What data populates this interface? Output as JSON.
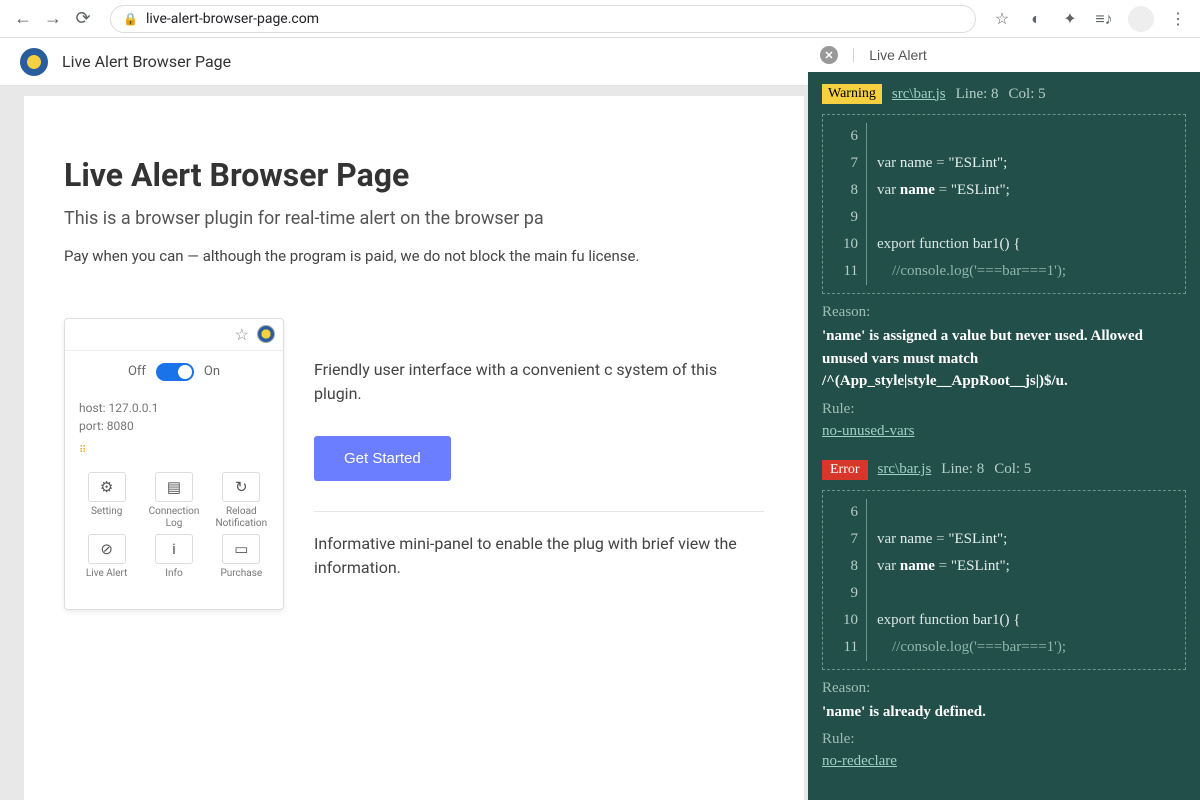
{
  "browser": {
    "url": "live-alert-browser-page.com"
  },
  "titleBar": {
    "title": "Live Alert Browser Page"
  },
  "page": {
    "heading": "Live Alert Browser Page",
    "subtitle": "This is a browser plugin for real-time alert on the browser pa",
    "desc": "Pay when you can — although the program is paid, we do not block the main fu license.",
    "feature1": "Friendly user interface with a convenient c system of this plugin.",
    "getStarted": "Get Started",
    "feature2": "Informative mini-panel to enable the plug with brief view the information."
  },
  "popup": {
    "off": "Off",
    "on": "On",
    "host": "host: 127.0.0.1",
    "port": "port: 8080",
    "cells": [
      {
        "icon": "⚙",
        "label": "Setting"
      },
      {
        "icon": "▤",
        "label": "Connection Log"
      },
      {
        "icon": "↻",
        "label": "Reload Notification"
      },
      {
        "icon": "⊘",
        "label": "Live Alert"
      },
      {
        "icon": "i",
        "label": "Info"
      },
      {
        "icon": "▭",
        "label": "Purchase"
      }
    ]
  },
  "alertPanel": {
    "title": "Live Alert",
    "blocks": [
      {
        "badge": "Warning",
        "badgeClass": "badge-warning",
        "file": "src\\bar.js",
        "line": "Line: 8",
        "col": "Col: 5",
        "code": [
          {
            "n": "6",
            "html": ""
          },
          {
            "n": "7",
            "html": "<span class='kw'>var</span>  name  <span class='op'>=</span>  <span class='str'>\"ESLint\";</span>"
          },
          {
            "n": "8",
            "html": "<span class='kw'>var</span>  <span class='bold'>name</span>  <span class='op'>=</span>  <span class='str'>\"ESLint\";</span>"
          },
          {
            "n": "9",
            "html": ""
          },
          {
            "n": "10",
            "html": "<span class='kw'>export  function</span>  bar1() {"
          },
          {
            "n": "11",
            "html": "&nbsp;&nbsp;&nbsp;&nbsp;<span class='cm'>//console.log('===bar===1');</span>"
          }
        ],
        "reasonLabel": "Reason:",
        "reason": "'name' is assigned a value but never used. Allowed unused vars must match /^(App_style|style__AppRoot__js|)$/u.",
        "ruleLabel": "Rule:",
        "rule": "no-unused-vars"
      },
      {
        "badge": "Error",
        "badgeClass": "badge-error",
        "file": "src\\bar.js",
        "line": "Line: 8",
        "col": "Col: 5",
        "code": [
          {
            "n": "6",
            "html": ""
          },
          {
            "n": "7",
            "html": "<span class='kw'>var</span>  name  <span class='op'>=</span>  <span class='str'>\"ESLint\";</span>"
          },
          {
            "n": "8",
            "html": "<span class='kw'>var</span>  <span class='bold'>name</span>  <span class='op'>=</span>  <span class='str'>\"ESLint\";</span>"
          },
          {
            "n": "9",
            "html": ""
          },
          {
            "n": "10",
            "html": "<span class='kw'>export  function</span>  bar1() {"
          },
          {
            "n": "11",
            "html": "&nbsp;&nbsp;&nbsp;&nbsp;<span class='cm'>//console.log('===bar===1');</span>"
          }
        ],
        "reasonLabel": "Reason:",
        "reason": "'name' is already defined.",
        "ruleLabel": "Rule:",
        "rule": "no-redeclare"
      }
    ]
  }
}
